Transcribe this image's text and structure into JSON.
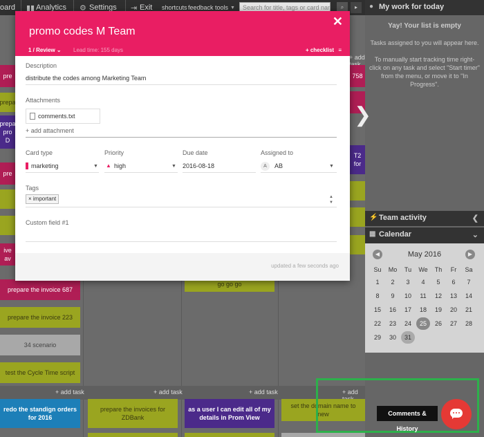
{
  "topbar": {
    "board_label": "oard",
    "analytics": "Analytics",
    "settings": "Settings",
    "exit": "Exit",
    "shortcuts": "shortcuts",
    "feedback": "feedback",
    "tools": "tools",
    "search_placeholder": "Search for title, tags or card name"
  },
  "board": {
    "add_task": "+ add task",
    "cards": {
      "c1": "pre",
      "c2": "prepa",
      "c3a": "prepa",
      "c3b": "pro",
      "c3c": "D",
      "c4": "pre",
      "c5": "ive av",
      "c6": "prepare the invoice 687",
      "c7": "prepare the invoice 223",
      "c8": "34 scenario",
      "c9": "test the Cycle Time script",
      "c10": "go go go",
      "c11": "758",
      "c12": "T2",
      "c13": "for",
      "b1": "redo the standign orders for 2016",
      "b2": "prepare the invoices for ZDBank",
      "b3": "as a user I can edit all of my details in Prom View",
      "b4": "set the domain name to new"
    }
  },
  "modal": {
    "title": "promo codes M Team",
    "stage": "1 / Review",
    "lead_time": "Lead time: 155 days",
    "checklist": "+ checklist",
    "description_label": "Description",
    "description": "distribute the codes among Marketing Team",
    "attachments_label": "Attachments",
    "attachment_file": "comments.txt",
    "add_attachment": "+ add attachment",
    "card_type_label": "Card type",
    "card_type": "marketing",
    "priority_label": "Priority",
    "priority": "high",
    "due_label": "Due date",
    "due": "2016-08-18",
    "assigned_label": "Assigned to",
    "assigned_avatar": "A",
    "assigned": "AB",
    "tags_label": "Tags",
    "tag": "important",
    "custom_label": "Custom field #1",
    "updated": "updated a few seconds ago"
  },
  "right_panel": {
    "mywork_title": "My work for today",
    "empty_title": "Yay! Your list is empty",
    "empty_l1": "Tasks assigned to you will appear here.",
    "empty_l2": "To manually start tracking time right-click on any task and select \"Start timer\" from the menu, or move it to \"In Progress\".",
    "team_activity": "Team activity",
    "calendar": "Calendar",
    "month": "May 2016",
    "dow": [
      "Su",
      "Mo",
      "Tu",
      "We",
      "Th",
      "Fr",
      "Sa"
    ],
    "weeks": [
      [
        "1",
        "2",
        "3",
        "4",
        "5",
        "6",
        "7"
      ],
      [
        "8",
        "9",
        "10",
        "11",
        "12",
        "13",
        "14"
      ],
      [
        "15",
        "16",
        "17",
        "18",
        "19",
        "20",
        "21"
      ],
      [
        "22",
        "23",
        "24",
        "25",
        "26",
        "27",
        "28"
      ],
      [
        "29",
        "30",
        "31",
        "",
        "",
        "",
        ""
      ]
    ]
  },
  "comments": {
    "tooltip": "Comments & History"
  },
  "colors": {
    "accent": "#e91e63",
    "comments_button": "#e53935",
    "highlight": "#2db04b"
  }
}
